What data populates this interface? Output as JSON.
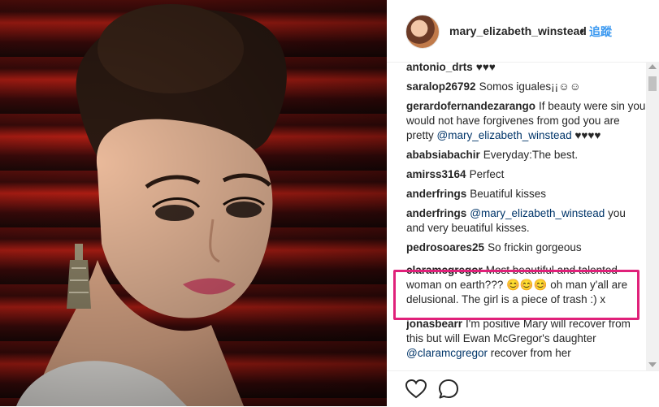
{
  "header": {
    "username": "mary_elizabeth_winstead",
    "separator": "•",
    "follow_label": "追蹤"
  },
  "comments": [
    {
      "user": "antonio_drts",
      "text": "♥♥♥"
    },
    {
      "user": "saralop26792",
      "text": "Somos iguales¡¡☺☺"
    },
    {
      "user": "gerardofernandezarango",
      "text": "If beauty were sin you would not have forgivenes from god you are pretty",
      "mention": "@mary_elizabeth_winstead",
      "after": " ♥♥♥♥"
    },
    {
      "user": "ababsiabachir",
      "text": "Everyday:The best."
    },
    {
      "user": "amirss3164",
      "text": "Perfect"
    },
    {
      "user": "anderfrings",
      "text": "Beuatiful kisses"
    },
    {
      "user": "anderfrings",
      "mention": "@mary_elizabeth_winstead",
      "after": " you and very beuatiful kisses."
    },
    {
      "user": "pedrosoares25",
      "text": "So frickin gorgeous"
    },
    {
      "user": "claramcgregor",
      "text": "Most beautiful and talented woman on earth??? 😊😊😊 oh man y'all are delusional. The girl is a piece of trash :) x"
    },
    {
      "user": "jonasbearr",
      "text": "I'm positive Mary will recover from this but will Ewan McGregor's daughter",
      "mention": "@claramcgregor",
      "after": " recover from her"
    }
  ],
  "actions": {
    "like_icon": "heart-icon",
    "comment_icon": "speech-bubble-icon"
  },
  "colors": {
    "highlight": "#e0217a",
    "link": "#3897f0",
    "mention": "#003569"
  }
}
